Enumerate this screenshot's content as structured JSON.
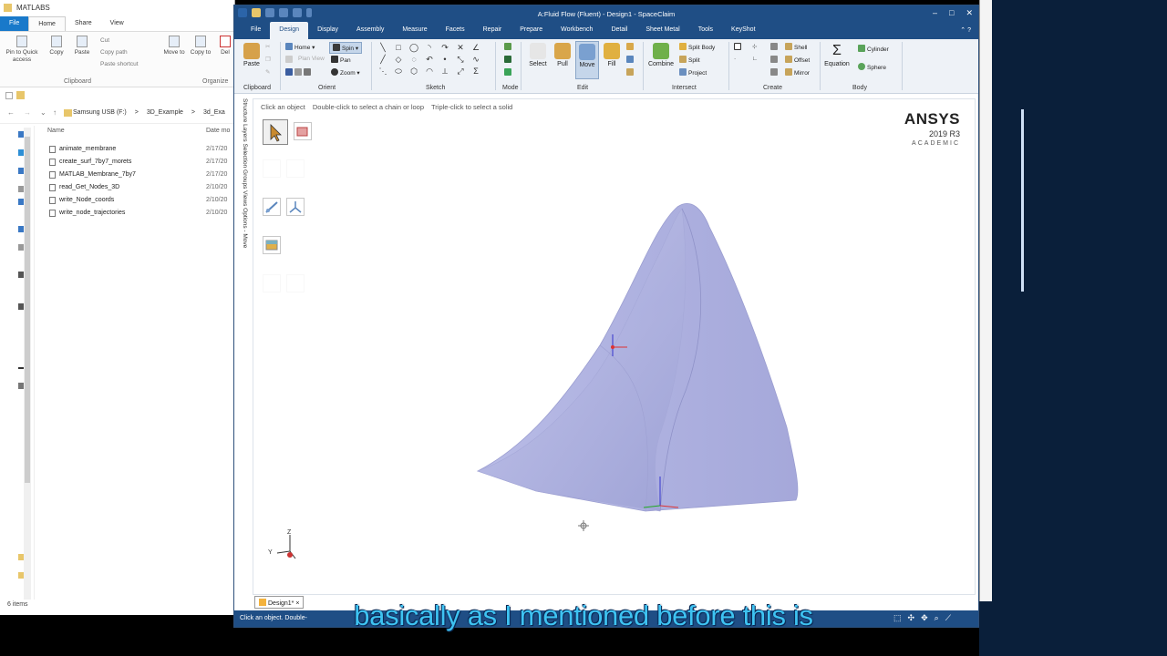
{
  "explorer": {
    "title": "MATLABS",
    "tabs": [
      "File",
      "Home",
      "Share",
      "View"
    ],
    "ribbon": {
      "pin": "Pin to Quick access",
      "copy": "Copy",
      "paste": "Paste",
      "cut": "Cut",
      "copy_path": "Copy path",
      "paste_shortcut": "Paste shortcut",
      "move_to": "Move to",
      "copy_to": "Copy to",
      "delete": "Del",
      "group_clipboard": "Clipboard",
      "group_organize": "Organize"
    },
    "breadcrumbs": [
      "Samsung USB (F:)",
      ">",
      "3D_Example",
      ">",
      "3d_Exa"
    ],
    "col_name": "Name",
    "col_date": "Date mo",
    "files": [
      {
        "name": "animate_membrane",
        "date": "2/17/20"
      },
      {
        "name": "create_surf_7by7_morets",
        "date": "2/17/20"
      },
      {
        "name": "MATLAB_Membrane_7by7",
        "date": "2/17/20"
      },
      {
        "name": "read_Get_Nodes_3D",
        "date": "2/10/20"
      },
      {
        "name": "write_Node_coords",
        "date": "2/10/20"
      },
      {
        "name": "write_node_trajectories",
        "date": "2/10/20"
      }
    ],
    "status": "6 items"
  },
  "spaceclaim": {
    "title": "A:Fluid Flow (Fluent) - Design1 - SpaceClaim",
    "tabs": [
      "File",
      "Design",
      "Display",
      "Assembly",
      "Measure",
      "Facets",
      "Repair",
      "Prepare",
      "Workbench",
      "Detail",
      "Sheet Metal",
      "Tools",
      "KeyShot"
    ],
    "active_tab": "Design",
    "ribbon": {
      "paste": "Paste",
      "home": "Home",
      "spin": "Spin",
      "plan_view": "Plan View",
      "pan": "Pan",
      "zoom": "Zoom",
      "select": "Select",
      "pull": "Pull",
      "move": "Move",
      "fill": "Fill",
      "combine": "Combine",
      "split_body": "Split Body",
      "split": "Split",
      "project": "Project",
      "shell": "Shell",
      "offset": "Offset",
      "mirror": "Mirror",
      "equation": "Equation",
      "cylinder": "Cylinder",
      "sphere": "Sphere",
      "groups": [
        "Clipboard",
        "Orient",
        "Sketch",
        "Mode",
        "Edit",
        "Intersect",
        "Create",
        "Body"
      ]
    },
    "side_tabs": "Structure  Layers  Selection  Groups  Views  Options - Move",
    "hint": [
      "Click an object",
      "Double-click to select a chain or loop",
      "Triple-click to select a solid"
    ],
    "logo": {
      "brand": "ANSYS",
      "version": "2019 R3",
      "edition": "ACADEMIC"
    },
    "axis": {
      "z": "Z",
      "y": "Y"
    },
    "doc_tab": "Design1*",
    "status": "Click an object. Double-"
  },
  "caption": "basically as I mentioned before this is",
  "colors": {
    "title_bar": "#1f4e85",
    "shape": "#b0b3e0",
    "caption": "#3ec3f2"
  }
}
